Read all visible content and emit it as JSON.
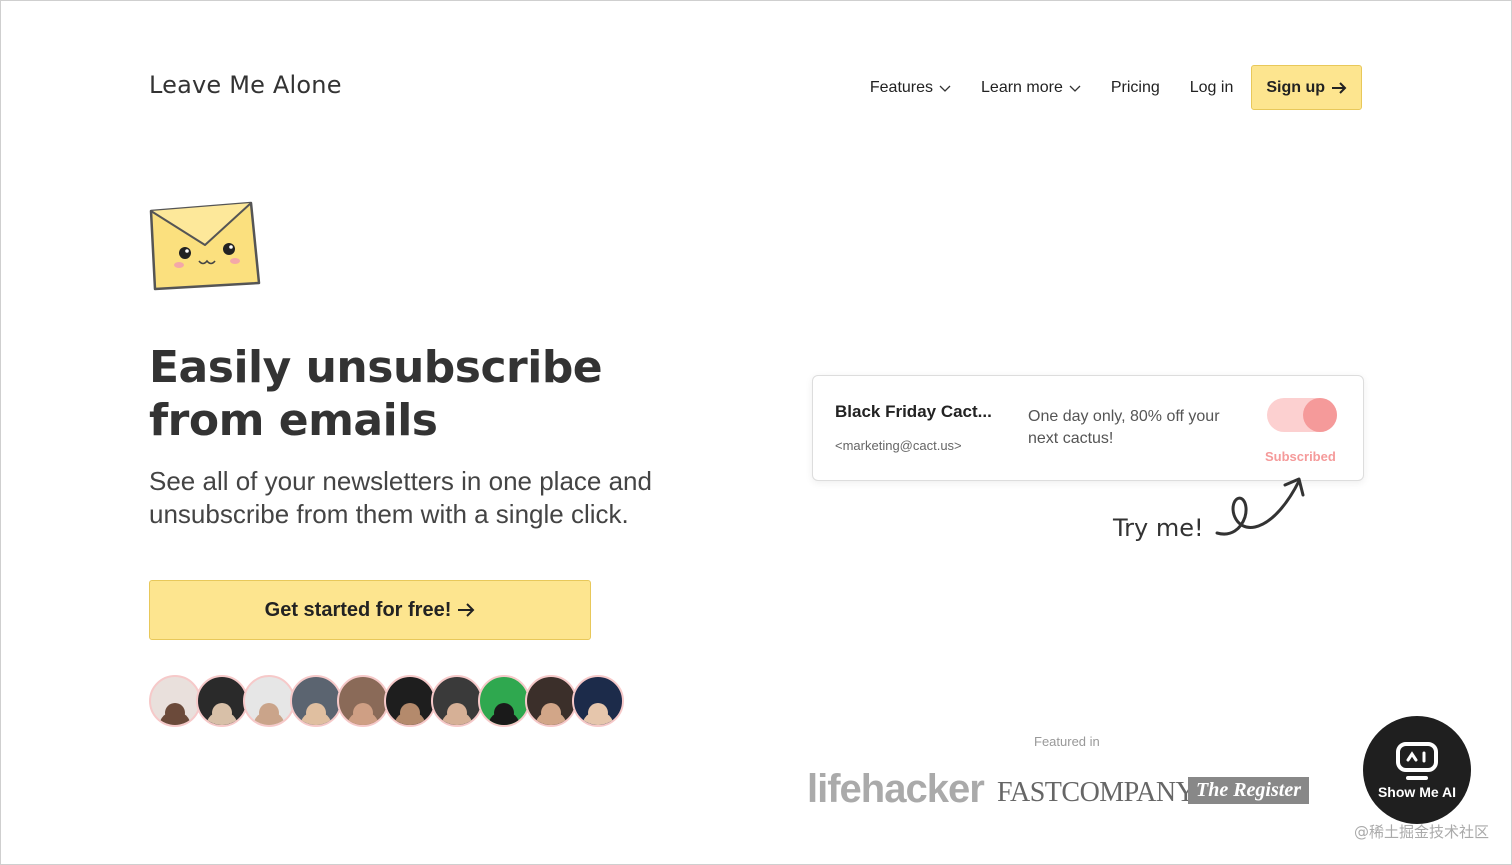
{
  "header": {
    "logo": "Leave Me Alone",
    "nav": {
      "features": "Features",
      "learn_more": "Learn more",
      "pricing": "Pricing",
      "login": "Log in",
      "signup": "Sign up"
    }
  },
  "hero": {
    "title_line1": "Easily unsubscribe",
    "title_line2": "from emails",
    "subtitle": "See all of your newsletters in one place and unsubscribe from them with a single click.",
    "cta": "Get started for free!",
    "avatar_count": 10
  },
  "demo_card": {
    "sender": "Black Friday Cact...",
    "email": "<marketing@cact.us>",
    "subject": "One day only, 80% off your next cactus!",
    "status": "Subscribed",
    "toggle_on": true
  },
  "try_me": "Try me!",
  "featured": {
    "label": "Featured in",
    "logos": [
      "lifehacker",
      "FASTCOMPANY",
      "The Register"
    ]
  },
  "widget": {
    "label": "Show Me AI"
  },
  "watermark": "@稀土掘金技术社区",
  "colors": {
    "accent_yellow": "#fde58f",
    "toggle_pink": "#f59a9a",
    "avatar_border": "#f6c9c9"
  },
  "icons": {
    "nav_chevron": "chevron-down-icon",
    "arrow": "arrow-right-icon",
    "widget": "robot-icon"
  }
}
